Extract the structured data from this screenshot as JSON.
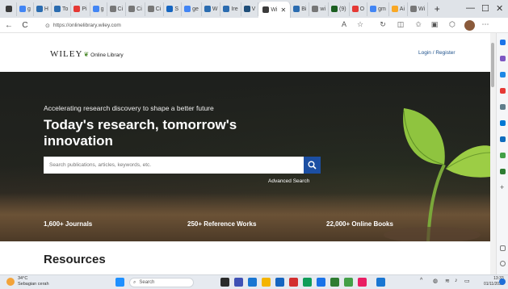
{
  "browser": {
    "tabs": [
      {
        "label": "",
        "color": "#3b3b3b"
      },
      {
        "label": "g",
        "color": "#4285f4"
      },
      {
        "label": "H",
        "color": "#2b6cb0"
      },
      {
        "label": "To",
        "color": "#2b6cb0"
      },
      {
        "label": "Pi",
        "color": "#e53935"
      },
      {
        "label": "g",
        "color": "#4285f4"
      },
      {
        "label": "Ci",
        "color": "#777777"
      },
      {
        "label": "Ci",
        "color": "#777777"
      },
      {
        "label": "Ci",
        "color": "#777777"
      },
      {
        "label": "S",
        "color": "#1565c0"
      },
      {
        "label": "ge",
        "color": "#4285f4"
      },
      {
        "label": "W",
        "color": "#2b6cb0"
      },
      {
        "label": "Ire",
        "color": "#2b6cb0"
      },
      {
        "label": "V",
        "color": "#1f4e79"
      },
      {
        "label": "Wi",
        "color": "#3b3b3b",
        "active": true
      },
      {
        "label": "Bi",
        "color": "#2b6cb0"
      },
      {
        "label": "wi",
        "color": "#777777"
      },
      {
        "label": "(9)",
        "color": "#1b5e20"
      },
      {
        "label": "O",
        "color": "#e53935"
      },
      {
        "label": "gm",
        "color": "#4285f4"
      },
      {
        "label": "Ai",
        "color": "#f9a825"
      },
      {
        "label": "Wi",
        "color": "#777777"
      }
    ],
    "new_tab": "+",
    "minimize": "—",
    "restore": "☐",
    "close": "✕",
    "back": "←",
    "reload": "C",
    "url": "https://onlinelibrary.wiley.com"
  },
  "page": {
    "logo_main": "WILEY",
    "logo_sub": "Online Library",
    "login": "Login / Register",
    "tagline": "Accelerating research discovery to shape a better future",
    "headline": "Today's research, tomorrow's innovation",
    "search_placeholder": "Search publications, articles, keywords, etc.",
    "advanced_search": "Advanced Search",
    "stats": [
      "1,600+ Journals",
      "250+ Reference Works",
      "22,000+ Online Books"
    ],
    "resources": "Resources"
  },
  "taskbar": {
    "weather_temp": "34°C",
    "weather_desc": "Sebagian cerah",
    "search_label": "Search",
    "time": "13:33",
    "date": "01/11/2023"
  },
  "colors": {
    "brand_blue": "#1c4fa3",
    "link_blue": "#1b4f8a",
    "leaf_green": "#4d8a2f"
  }
}
